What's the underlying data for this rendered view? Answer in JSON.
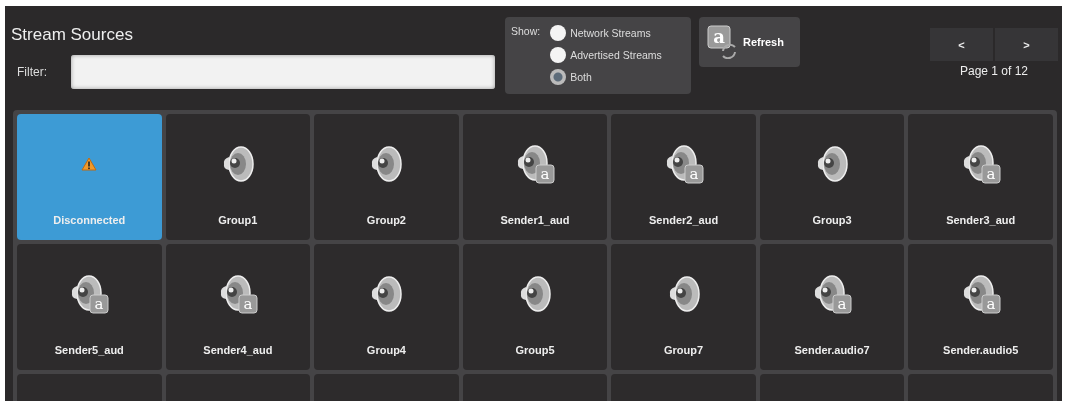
{
  "title": "Stream Sources",
  "filter": {
    "label": "Filter:"
  },
  "show": {
    "label": "Show:",
    "options": [
      {
        "label": "Network Streams",
        "selected": false
      },
      {
        "label": "Advertised Streams",
        "selected": false
      },
      {
        "label": "Both",
        "selected": true
      }
    ]
  },
  "refresh_button": {
    "label": "Refresh",
    "icon_letter": "a"
  },
  "pager": {
    "prev": "<",
    "next": ">",
    "page": "Page 1 of 12"
  },
  "sources": [
    {
      "name": "Disconnected",
      "kind": "warning",
      "selected": true
    },
    {
      "name": "Group1",
      "kind": "group",
      "selected": false
    },
    {
      "name": "Group2",
      "kind": "group",
      "selected": false
    },
    {
      "name": "Sender1_aud",
      "kind": "sender",
      "icon_letter": "a",
      "selected": false
    },
    {
      "name": "Sender2_aud",
      "kind": "sender",
      "icon_letter": "a",
      "selected": false
    },
    {
      "name": "Group3",
      "kind": "group",
      "selected": false
    },
    {
      "name": "Sender3_aud",
      "kind": "sender",
      "icon_letter": "a",
      "selected": false
    },
    {
      "name": "Sender5_aud",
      "kind": "sender",
      "icon_letter": "a",
      "selected": false
    },
    {
      "name": "Sender4_aud",
      "kind": "sender",
      "icon_letter": "a",
      "selected": false
    },
    {
      "name": "Group4",
      "kind": "group",
      "selected": false
    },
    {
      "name": "Group5",
      "kind": "group",
      "selected": false
    },
    {
      "name": "Group7",
      "kind": "group",
      "selected": false
    },
    {
      "name": "Sender.audio7",
      "kind": "sender",
      "icon_letter": "a",
      "selected": false
    },
    {
      "name": "Sender.audio5",
      "kind": "sender",
      "icon_letter": "a",
      "selected": false
    }
  ]
}
